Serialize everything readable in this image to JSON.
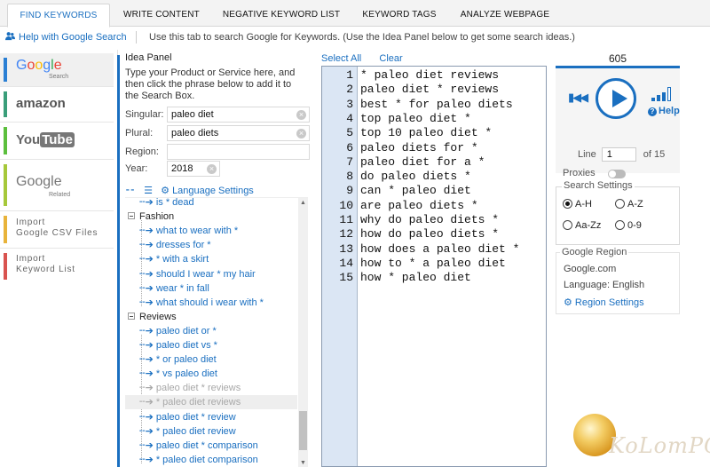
{
  "tabs": [
    {
      "label": "FIND KEYWORDS",
      "active": true
    },
    {
      "label": "WRITE CONTENT"
    },
    {
      "label": "NEGATIVE KEYWORD LIST"
    },
    {
      "label": "KEYWORD TAGS"
    },
    {
      "label": "ANALYZE WEBPAGE"
    }
  ],
  "help": {
    "link": "Help with Google Search",
    "description": "Use this tab to search Google for Keywords. (Use the Idea Panel below to get some search ideas.)"
  },
  "engines": {
    "google": {
      "logo": "Google",
      "sub": "Search",
      "accent": "#2a7fd4"
    },
    "amazon": {
      "logo": "amazon",
      "accent": "#3a9e7a"
    },
    "youtube": {
      "logo": "YouTube",
      "accent": "#5cbf3d"
    },
    "google_related": {
      "logo": "Google",
      "sub": "Related",
      "accent": "#a6c83a"
    },
    "import_csv": {
      "line1": "Import",
      "line2": "Google CSV Files",
      "accent": "#e8b33a"
    },
    "import_keyword": {
      "line1": "Import",
      "line2": "Keyword List",
      "accent": "#d9534f"
    }
  },
  "idea_panel": {
    "title": "Idea Panel",
    "instructions": "Type your Product or Service here, and then click the phrase below to add it to the Search Box.",
    "singular": {
      "label": "Singular:",
      "value": "paleo diet"
    },
    "plural": {
      "label": "Plural:",
      "value": "paleo diets"
    },
    "region": {
      "label": "Region:",
      "value": ""
    },
    "year": {
      "label": "Year:",
      "value": "2018"
    },
    "language_settings": "Language Settings",
    "tree": [
      {
        "text": "is * dead",
        "kind": "item",
        "level": 1
      },
      {
        "text": "Fashion",
        "kind": "cat",
        "level": 0
      },
      {
        "text": "what to wear with *",
        "kind": "item",
        "level": 1
      },
      {
        "text": "dresses for *",
        "kind": "item",
        "level": 1
      },
      {
        "text": "* with a skirt",
        "kind": "item",
        "level": 1
      },
      {
        "text": "should I wear * my hair",
        "kind": "item",
        "level": 1
      },
      {
        "text": "wear * in fall",
        "kind": "item",
        "level": 1
      },
      {
        "text": "what should i wear with *",
        "kind": "item",
        "level": 1
      },
      {
        "text": "Reviews",
        "kind": "cat",
        "level": 0
      },
      {
        "text": "paleo diet or *",
        "kind": "item",
        "level": 1
      },
      {
        "text": "paleo diet vs *",
        "kind": "item",
        "level": 1
      },
      {
        "text": "* or paleo diet",
        "kind": "item",
        "level": 1
      },
      {
        "text": "* vs paleo diet",
        "kind": "item",
        "level": 1
      },
      {
        "text": "paleo diet * reviews",
        "kind": "used",
        "level": 1
      },
      {
        "text": "* paleo diet reviews",
        "kind": "used-sel",
        "level": 1
      },
      {
        "text": "paleo diet * review",
        "kind": "item",
        "level": 1
      },
      {
        "text": "* paleo diet review",
        "kind": "item",
        "level": 1
      },
      {
        "text": "paleo diet * comparison",
        "kind": "item",
        "level": 1
      },
      {
        "text": "* paleo diet comparison",
        "kind": "item",
        "level": 1
      }
    ]
  },
  "editor": {
    "select_all": "Select All",
    "clear": "Clear",
    "lines": [
      "* paleo diet reviews",
      "paleo diet * reviews",
      "best * for paleo diets",
      "top paleo diet *",
      "top 10 paleo diet *",
      "paleo diets for *",
      "paleo diet for a *",
      "do paleo diets *",
      "can * paleo diet",
      "are paleo diets *",
      "why do paleo diets *",
      "how do paleo diets *",
      "how does a paleo diet *",
      "how to * a paleo diet",
      "how * paleo diet"
    ]
  },
  "controls": {
    "count": "605",
    "help": "Help",
    "line_label": "Line",
    "line_value": "1",
    "line_total": "of 15",
    "proxies": "Proxies",
    "accent": "#1a6fc0"
  },
  "search_settings": {
    "title": "Search Settings",
    "options": [
      {
        "label": "A-H",
        "checked": true
      },
      {
        "label": "A-Z",
        "checked": false
      },
      {
        "label": "Aa-Zz",
        "checked": false
      },
      {
        "label": "0-9",
        "checked": false
      }
    ]
  },
  "google_region": {
    "title": "Google Region",
    "domain": "Google.com",
    "language": "Language: English",
    "settings": "Region Settings"
  },
  "watermark": {
    "text": "KoLomPC"
  }
}
